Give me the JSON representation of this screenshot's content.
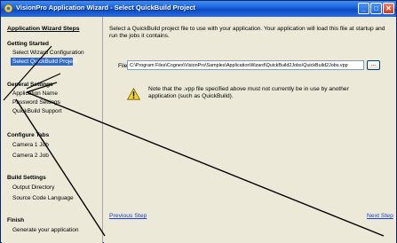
{
  "window": {
    "title": "VisionPro Application Wizard - Select QuickBuild Project",
    "minimize": "_",
    "maximize": "□",
    "close": "✕"
  },
  "sidebar": {
    "heading": "Application Wizard Steps",
    "groups": [
      {
        "title": "Getting Started",
        "items": [
          "Select Wizard Configuration",
          "Select QuickBuild Project"
        ]
      },
      {
        "title": "General Settings",
        "items": [
          "Application Name",
          "Password Settings",
          "QuickBuild Support"
        ]
      },
      {
        "title": "Configure Tabs",
        "items": [
          "Camera 1 Job",
          "Camera 2 Job"
        ]
      },
      {
        "title": "Build Settings",
        "items": [
          "Output Directory",
          "Source Code Language"
        ]
      },
      {
        "title": "Finish",
        "items": [
          "Generate your application"
        ]
      }
    ],
    "active_item": "Select QuickBuild Project"
  },
  "main": {
    "description": "Select a QuickBuild project file to use with your application.  Your application will load this file at startup and run the jobs it contains.",
    "file_label": "File",
    "file_value": "C:\\Program Files\\Cognex\\VisionPro\\Samples\\ApplicationWizard\\QuickBuild2Jobs\\QuickBuild2Jobs.vpp",
    "browse_label": "...",
    "note": "Note that the .vpp file specified above must not currently be in use by another application (such as QuickBuild).",
    "warning_icon": "warning-icon"
  },
  "footer": {
    "previous": "Previous Step",
    "next": "Next Step"
  },
  "colors": {
    "titlebar": "#0b49c4",
    "selection": "#316ac5",
    "link": "#1a3fcf",
    "face": "#ece9d8"
  }
}
